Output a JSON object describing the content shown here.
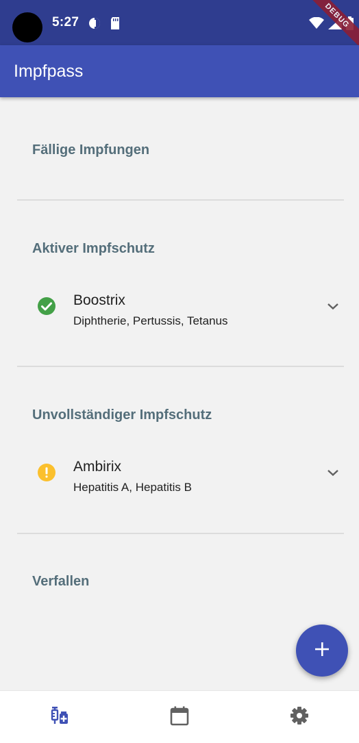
{
  "status_bar": {
    "time": "5:27",
    "debug_label": "DEBUG",
    "icons": [
      "camera-hole",
      "data-saver-icon",
      "sd-card-icon",
      "wifi-icon",
      "signal-icon",
      "battery-icon"
    ]
  },
  "app_bar": {
    "title": "Impfpass"
  },
  "sections": {
    "due": {
      "title": "Fällige Impfungen"
    },
    "active": {
      "title": "Aktiver Impfschutz",
      "items": [
        {
          "name": "Boostrix",
          "diseases": "Diphtherie, Pertussis, Tetanus",
          "status_icon": "check-circle-icon",
          "status_color": "#43a047"
        }
      ]
    },
    "incomplete": {
      "title": "Unvollständiger Impfschutz",
      "items": [
        {
          "name": "Ambirix",
          "diseases": "Hepatitis A, Hepatitis B",
          "status_icon": "warning-circle-icon",
          "status_color": "#fbc02d"
        }
      ]
    },
    "expired": {
      "title": "Verfallen"
    }
  },
  "fab": {
    "icon": "plus-icon"
  },
  "bottom_nav": {
    "items": [
      {
        "icon": "vaccine-icon",
        "active": true
      },
      {
        "icon": "calendar-icon",
        "active": false
      },
      {
        "icon": "gear-icon",
        "active": false
      }
    ]
  },
  "colors": {
    "primary": "#3f51b5",
    "status_bar": "#2f3d8f",
    "section_header": "#546e7a",
    "background": "#f2f2f2"
  }
}
